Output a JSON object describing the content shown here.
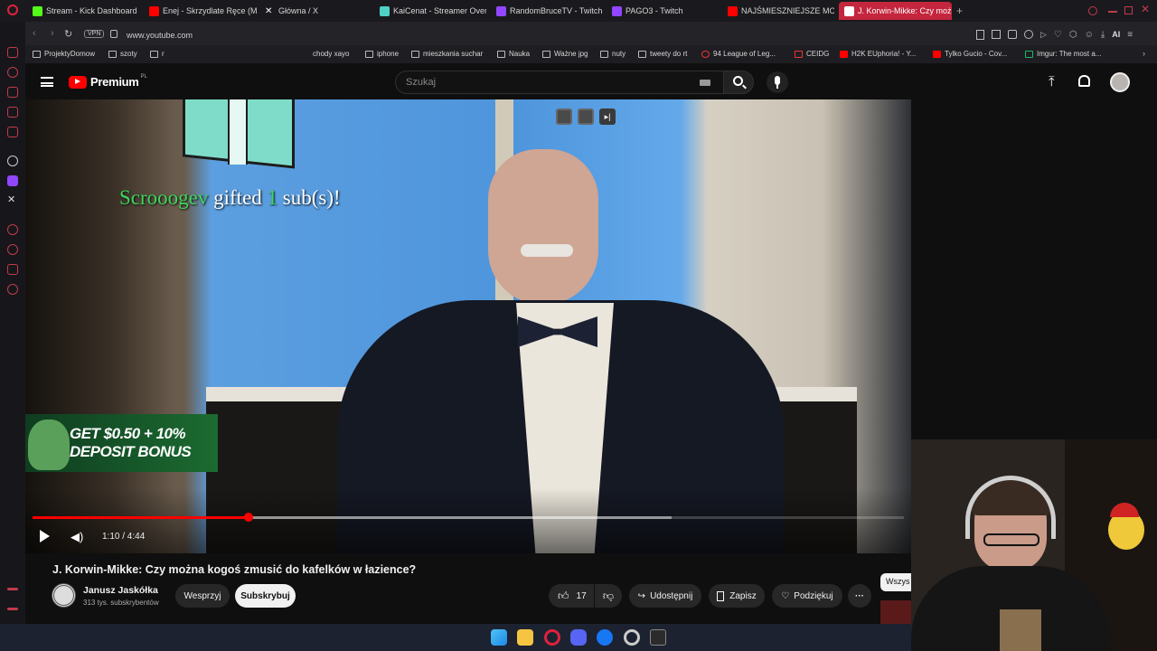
{
  "browser": {
    "tabs": [
      {
        "label": "Stream - Kick Dashboard",
        "color": "#53fc18"
      },
      {
        "label": "Enej - Skrzydlate Ręce (M",
        "color": "#ff0000"
      },
      {
        "label": "Główna / X",
        "color": "#ffffff"
      },
      {
        "label": "KaiCenat - Streamer Over",
        "color": "#4fd1c5"
      },
      {
        "label": "RandomBruceTV - Twitch",
        "color": "#9146ff"
      },
      {
        "label": "PAGO3 - Twitch",
        "color": "#9146ff"
      },
      {
        "label": "NAJŚMIESZNIEJSZE MOM",
        "color": "#ff0000"
      },
      {
        "label": "J. Korwin-Mikke: Czy moż",
        "color": "#ff0000"
      }
    ],
    "vpn_label": "VPN",
    "url": "www.youtube.com",
    "ai_label": "AI",
    "bookmarks": [
      "ProjektyDomow",
      "szoty",
      "r",
      "chody xayo",
      "iphone",
      "mieszkania suchar",
      "Nauka",
      "Ważne jpg",
      "nuty",
      "tweety do rt",
      "94 League of Leg...",
      "CEIDG",
      "H2K EUphoria! - Y...",
      "Tylko Gucio - Cov...",
      "Imgur: The most a..."
    ]
  },
  "youtube": {
    "logo_text": "Premium",
    "logo_region": "PL",
    "search_placeholder": "Szukaj",
    "video": {
      "title": "J. Korwin-Mikke: Czy można kogoś zmusić do kafelków w łazience?",
      "time": "1:10 / 4:44",
      "progress_fraction": 0.248,
      "buffered_fraction": 0.733
    },
    "channel": {
      "name": "Janusz Jaskółka",
      "subs": "313 tys. subskrybentów",
      "support_label": "Wesprzyj",
      "subscribe_label": "Subskrybuj"
    },
    "actions": {
      "likes": "17",
      "share": "Udostępnij",
      "save": "Zapisz",
      "thanks": "Podziękuj"
    },
    "chip": "Wszys"
  },
  "overlay": {
    "gift_user": "Scrooogev",
    "gift_text_1": "gifted",
    "gift_count": "1",
    "gift_text_2": "sub(s)!",
    "ad_line1": "GET $0.50 + 10%",
    "ad_line2": "DEPOSIT BONUS"
  },
  "colors": {
    "accent_red": "#ff0000",
    "gift_green": "#3ed65e",
    "gift_box": "#7fdcc9",
    "tab_active": "#c4263d"
  }
}
